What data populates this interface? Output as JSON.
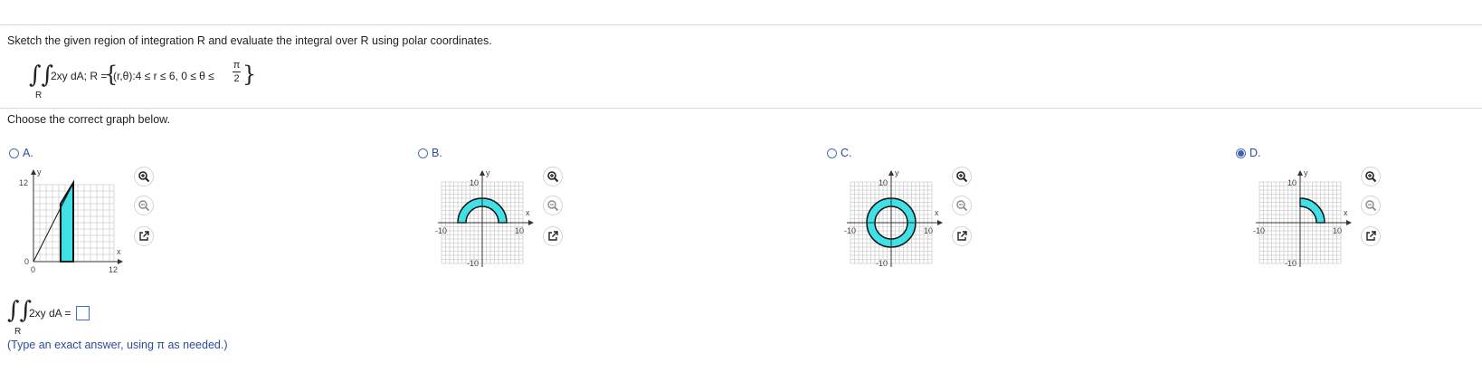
{
  "question": {
    "prompt": "Sketch the given region of integration R and evaluate the integral over R using polar coordinates.",
    "integrand": "2xy dA; R =",
    "region_set": "(r,θ):4 ≤ r ≤ 6, 0 ≤ θ ≤",
    "pi": "π",
    "two": "2",
    "sub_r": "R"
  },
  "choose_label": "Choose the correct graph below.",
  "options": [
    {
      "label": "A.",
      "selected": false,
      "y_label": "y",
      "x_label": "x",
      "tick_y_top": "12",
      "tick_y_bottom": "0",
      "tick_x_left": "0",
      "tick_x_right": "12"
    },
    {
      "label": "B.",
      "selected": false,
      "y_label": "y",
      "x_label": "x",
      "tick_top": "10",
      "tick_left": "-10",
      "tick_right": "10",
      "tick_bottom": "-10"
    },
    {
      "label": "C.",
      "selected": false,
      "y_label": "y",
      "x_label": "x",
      "tick_top": "10",
      "tick_left": "-10",
      "tick_right": "10",
      "tick_bottom": "-10"
    },
    {
      "label": "D.",
      "selected": true,
      "y_label": "y",
      "x_label": "x",
      "tick_top": "10",
      "tick_left": "-10",
      "tick_right": "10",
      "tick_bottom": "-10"
    }
  ],
  "icons": [
    "zoom-in-icon",
    "zoom-out-icon",
    "popout-icon"
  ],
  "colors": {
    "fill": "#40e0e6",
    "link": "#2a4d9c",
    "grid": "#c8c8c8"
  },
  "answer": {
    "integrand": "2xy dA =",
    "sub_r": "R",
    "value": "",
    "hint": "(Type an exact answer, using π as needed.)"
  }
}
